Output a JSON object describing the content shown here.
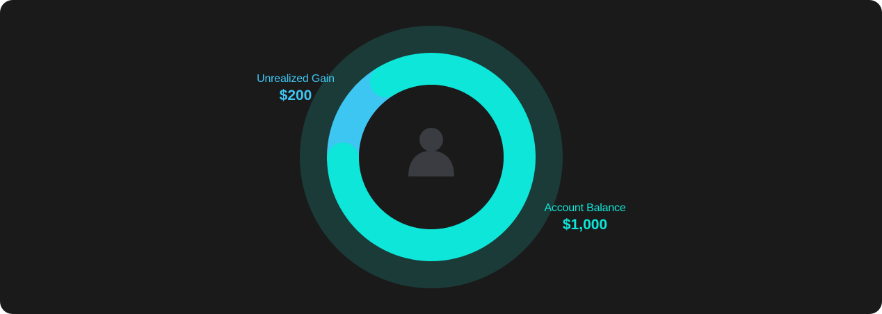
{
  "colors": {
    "background": "#1a1a1a",
    "ring_track": "#1b3b38",
    "account_balance": "#0de6d8",
    "unrealized_gain": "#3ec6f2",
    "avatar": "#3b3c42"
  },
  "chart_data": {
    "type": "donut",
    "center_icon": "user-icon",
    "slices": [
      {
        "name": "Unrealized Gain",
        "value": 200,
        "display": "$200",
        "color": "#3ec6f2"
      },
      {
        "name": "Account Balance",
        "value": 1000,
        "display": "$1,000",
        "color": "#0de6d8"
      }
    ]
  }
}
